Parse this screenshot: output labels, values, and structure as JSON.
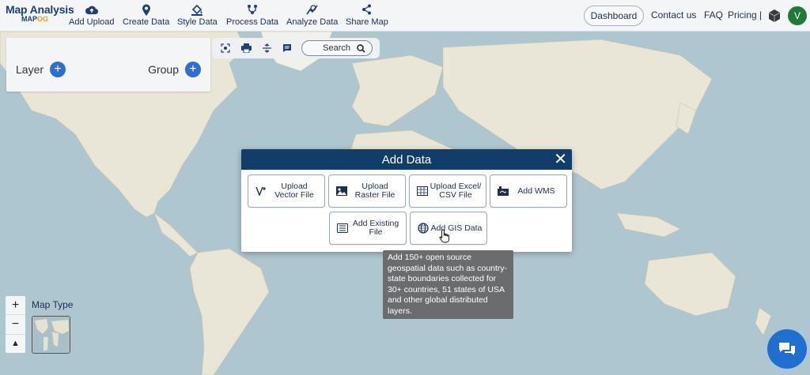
{
  "brand": {
    "title": "Map Analysis",
    "sub_a": "MAP",
    "sub_b": "OG"
  },
  "nav": [
    {
      "label": "Add Upload",
      "icon": "cloud-upload-icon"
    },
    {
      "label": "Create Data",
      "icon": "map-pin-icon"
    },
    {
      "label": "Style Data",
      "icon": "paint-bucket-icon"
    },
    {
      "label": "Process Data",
      "icon": "process-icon"
    },
    {
      "label": "Analyze Data",
      "icon": "analyze-icon"
    },
    {
      "label": "Share Map",
      "icon": "share-icon"
    }
  ],
  "header": {
    "dashboard": "Dashboard",
    "contact": "Contact us",
    "faq": "FAQ",
    "pricing": "Pricing |",
    "avatar": "V"
  },
  "layer_panel": {
    "layer": "Layer",
    "group": "Group",
    "plus": "+"
  },
  "toolbar": {
    "search": "Search"
  },
  "modal": {
    "title": "Add Data",
    "close": "✕",
    "options": [
      {
        "label": "Upload Vector File",
        "line1": "Upload",
        "line2": "Vector File",
        "icon": "vector-icon"
      },
      {
        "label": "Upload Raster File",
        "line1": "Upload",
        "line2": "Raster File",
        "icon": "raster-image-icon"
      },
      {
        "label": "Upload Excel/CSV File",
        "line1": "Upload Excel/",
        "line2": "CSV File",
        "icon": "spreadsheet-icon"
      },
      {
        "label": "Add WMS",
        "line1": "Add WMS",
        "line2": "",
        "icon": "wms-icon"
      },
      {
        "label": "Add Existing File",
        "line1": "Add Existing",
        "line2": "File",
        "icon": "existing-file-icon"
      },
      {
        "label": "Add GIS Data",
        "line1": "Add GIS Data",
        "line2": "",
        "icon": "globe-icon"
      }
    ]
  },
  "tooltip": {
    "text": "Add 150+ open source geospatial data such as country-state boundaries collected for 30+ countries, 51 states of USA and other global distributed layers."
  },
  "map_controls": {
    "zoom_in": "+",
    "zoom_out": "−",
    "north": "▲",
    "map_type": "Map Type"
  },
  "colors": {
    "primary": "#123d6b",
    "accent": "#2d6fd1",
    "nav_text": "#1c2f52",
    "avatar_bg": "#1f7a3a"
  }
}
